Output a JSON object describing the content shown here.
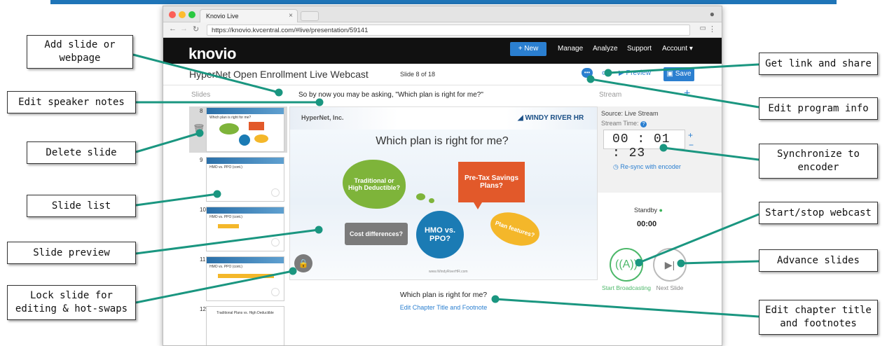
{
  "window": {
    "tab_title": "Knovio Live",
    "url": "https://knovio.kvcentral.com/#live/presentation/59141"
  },
  "navbar": {
    "logo": "knovio",
    "new_button": "+ New",
    "items": [
      "Manage",
      "Analyze",
      "Support",
      "Account ▾"
    ]
  },
  "presentation": {
    "title": "HyperNet Open Enrollment Live Webcast",
    "slide_counter": "Slide 8 of 18",
    "preview_label": "Preview",
    "save_label": "Save",
    "slides_label": "Slides",
    "stream_label": "Stream",
    "speaker_notes": "So by now you may be asking, \"Which plan is right for me?\""
  },
  "thumbnails": [
    {
      "num": "8",
      "title": "Which plan is right for me?"
    },
    {
      "num": "9",
      "title": "HMO vs. PPO (cont.)"
    },
    {
      "num": "10",
      "title": "HMO vs. PPO (cont.)"
    },
    {
      "num": "11",
      "title": "HMO vs. PPO (cont.)"
    },
    {
      "num": "12",
      "title": "Traditional Plans vs. High Deductible"
    }
  ],
  "slide": {
    "company": "HyperNet, Inc.",
    "brand": "WINDY RIVER HR",
    "heading": "Which plan is right for me?",
    "bubbles": {
      "traditional": "Traditional or High Deductible?",
      "pretax": "Pre-Tax Savings Plans?",
      "cost": "Cost differences?",
      "hmo": "HMO vs. PPO?",
      "features": "Plan features?"
    },
    "footer_url": "www.WindyRiverHR.com",
    "chapter_title": "Which plan is right for me?",
    "edit_chapter": "Edit Chapter Title and Footnote"
  },
  "stream": {
    "source": "Source: Live Stream",
    "time_label": "Stream Time:",
    "time": "00 : 01 : 23",
    "resync": "Re-sync with encoder",
    "standby": "Standby",
    "standby_time": "00:00",
    "start_label": "Start Broadcasting",
    "next_label": "Next Slide"
  },
  "callouts": {
    "add_slide": "Add slide or webpage",
    "speaker_notes": "Edit speaker notes",
    "delete_slide": "Delete slide",
    "slide_list": "Slide list",
    "slide_preview": "Slide preview",
    "lock_slide": "Lock slide for editing & hot-swaps",
    "get_link": "Get link and share",
    "program_info": "Edit program info",
    "synchronize": "Synchronize to encoder",
    "start_stop": "Start/stop webcast",
    "advance": "Advance slides",
    "chapter_title": "Edit chapter title and footnotes"
  },
  "colors": {
    "accent": "#2b7fd0",
    "connector": "#1a9680",
    "bubble_green": "#7eb43a",
    "bubble_orange": "#e2592a",
    "bubble_blue": "#1b7bb4",
    "bubble_yellow": "#f4b72a",
    "bubble_gray": "#7b7b7b"
  }
}
